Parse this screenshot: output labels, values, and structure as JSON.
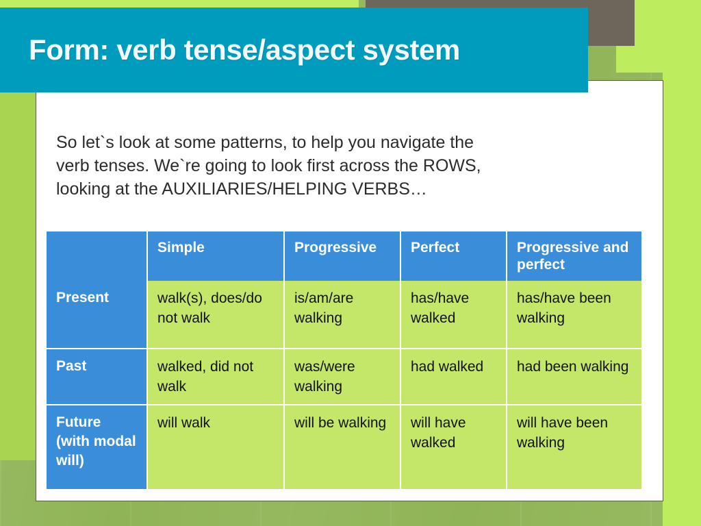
{
  "slide": {
    "title": "Form: verb tense/aspect system",
    "body_lines": [
      "So let`s look at some patterns, to help you navigate the",
      "verb tenses. We`re going to look first across the ROWS,",
      "looking at the AUXILIARIES/HELPING VERBS…"
    ]
  },
  "colors": {
    "title_bar": "#009cbe",
    "table_header": "#3a8dd8",
    "table_cell": "#c4e76a",
    "background_green": "#8fb455",
    "accent_lime": "#bdec5f",
    "accent_brown": "#6d665a"
  },
  "table": {
    "corner_label": "",
    "columns": [
      "Simple",
      "Progressive",
      "Perfect",
      "Progressive and perfect"
    ],
    "rows": [
      {
        "label": "Present",
        "cells": [
          "walk(s), does/do not walk",
          "is/am/are walking",
          "has/have walked",
          "has/have been walking"
        ]
      },
      {
        "label": "Past",
        "cells": [
          "walked, did not walk",
          "was/were walking",
          "had walked",
          "had been walking"
        ]
      },
      {
        "label": "Future (with modal will)",
        "cells": [
          "will walk",
          "will be walking",
          "will have walked",
          "will have been walking"
        ]
      }
    ]
  }
}
